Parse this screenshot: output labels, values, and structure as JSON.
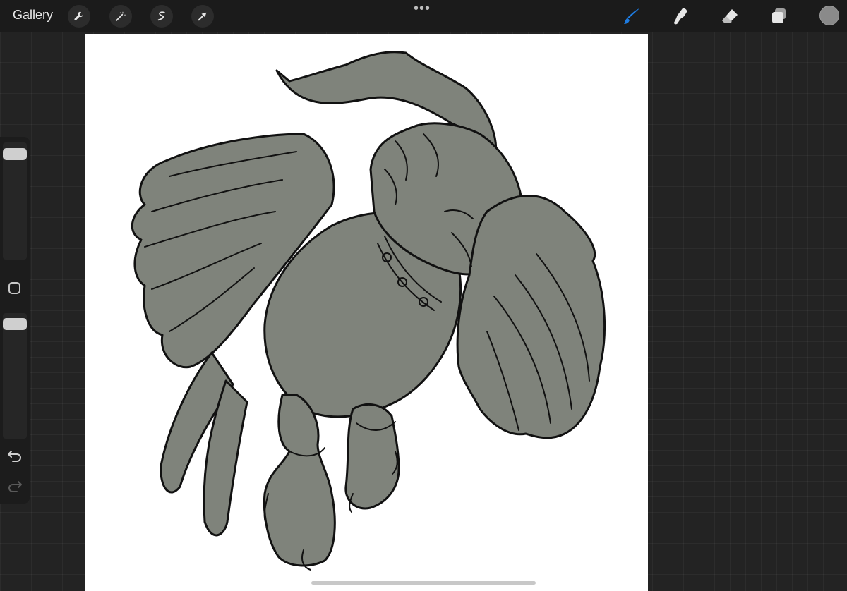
{
  "topbar": {
    "gallery_label": "Gallery",
    "left_tools": [
      "wrench-icon",
      "magic-wand-icon",
      "selection-icon",
      "transform-arrow-icon"
    ],
    "more_label": "•••",
    "right_tools": [
      "brush-icon",
      "smudge-icon",
      "eraser-icon",
      "layers-icon"
    ],
    "active_tool": "brush-icon",
    "accent_color": "#1e7be0",
    "current_color": "#8a8a8a"
  },
  "sidebar": {
    "controls": [
      "brush-size-slider",
      "modify-button",
      "opacity-slider",
      "undo-icon",
      "redo-icon"
    ]
  },
  "canvas": {
    "background": "#ffffff",
    "artwork_fill": "#7f837b",
    "artwork_stroke": "#111111"
  }
}
